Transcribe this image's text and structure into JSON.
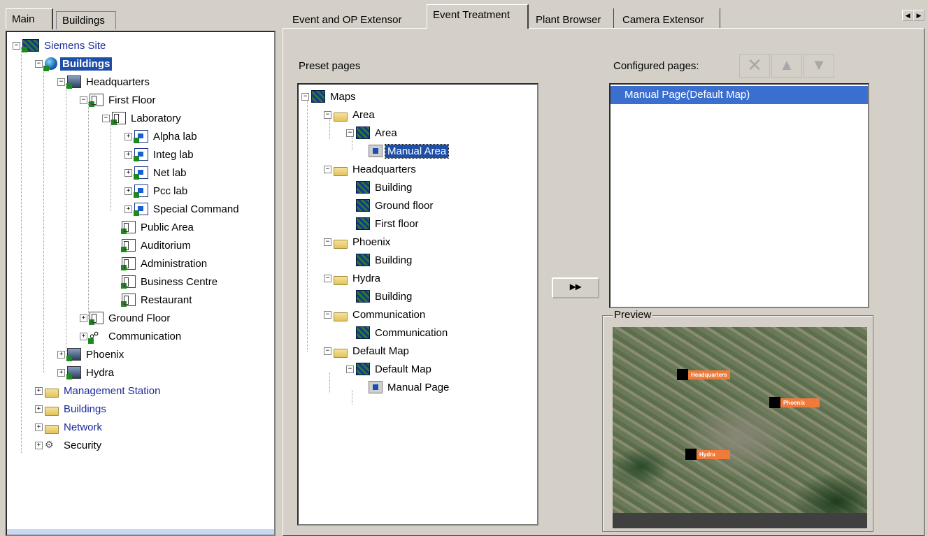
{
  "left_tabs": [
    "Main",
    "Buildings"
  ],
  "right_tabs": [
    "Event and OP Extensor",
    "Event Treatment",
    "Plant Browser",
    "Camera Extensor"
  ],
  "left_tree": {
    "root": "Siemens Site",
    "buildings": "Buildings",
    "headquarters": "Headquarters",
    "first_floor": "First Floor",
    "laboratory": "Laboratory",
    "labs": [
      "Alpha lab",
      "Integ lab",
      "Net lab",
      "Pcc lab",
      "Special Command"
    ],
    "areas": [
      "Public Area",
      "Auditorium",
      "Administration",
      "Business Centre",
      "Restaurant"
    ],
    "ground_floor": "Ground  Floor",
    "communication": "Communication",
    "phoenix": "Phoenix",
    "hydra": "Hydra",
    "top_folders": [
      "Management Station",
      "Buildings",
      "Network"
    ],
    "security": "Security"
  },
  "preset": {
    "label": "Preset pages",
    "maps": "Maps",
    "area_folder": "Area",
    "area_map": "Area",
    "manual_area": "Manual Area",
    "hq_folder": "Headquarters",
    "hq_items": [
      "Building",
      "Ground floor",
      "First floor"
    ],
    "phoenix_folder": "Phoenix",
    "phoenix_building": "Building",
    "hydra_folder": "Hydra",
    "hydra_building": "Building",
    "comm_folder": "Communication",
    "comm_item": "Communication",
    "default_folder": "Default Map",
    "default_map": "Default Map",
    "manual_page": "Manual Page"
  },
  "configured": {
    "label": "Configured pages:",
    "items": [
      "Manual Page(Default Map)"
    ]
  },
  "add_button": "▸▸",
  "preview": {
    "label": "Preview",
    "markers": [
      "Headquarters",
      "Phoenix",
      "Hydra"
    ]
  },
  "colors": {
    "selection": "#1e4fa8",
    "marker": "#f07a3a"
  }
}
